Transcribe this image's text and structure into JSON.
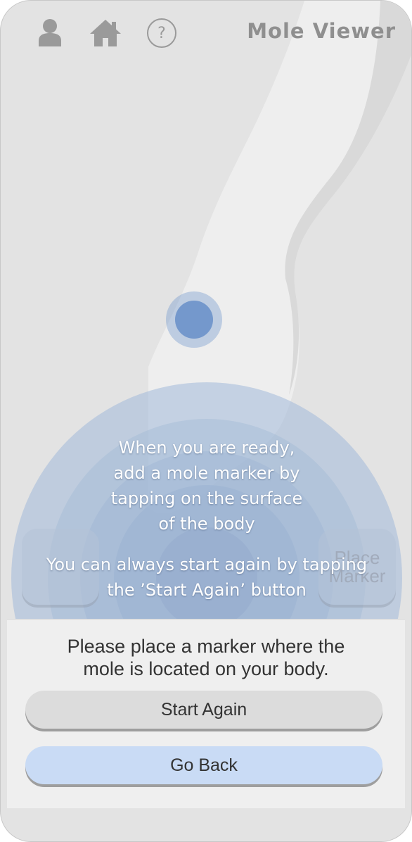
{
  "app": {
    "title": "Mole Viewer"
  },
  "topbar": {
    "icons": {
      "profile": "person-icon",
      "home": "home-icon",
      "help": "help-icon"
    },
    "help_glyph": "?"
  },
  "tutorial": {
    "line1": "When you are ready,",
    "line2": "add a mole marker by",
    "line3": "tapping on the surface",
    "line4": "of the body",
    "line5": "You can always start again by tapping",
    "line6": "the ’Start Again’ button"
  },
  "side_buttons": {
    "right_line1": "Place",
    "right_line2": "Marker"
  },
  "panel": {
    "message_line1": "Please place a marker where the",
    "message_line2": "mole is located on your body.",
    "start_again_label": "Start Again",
    "go_back_label": "Go Back"
  },
  "colors": {
    "accent": "#5a82c3",
    "go_back_bg": "#c9dbf5",
    "overlay": "#a9bfdb"
  }
}
